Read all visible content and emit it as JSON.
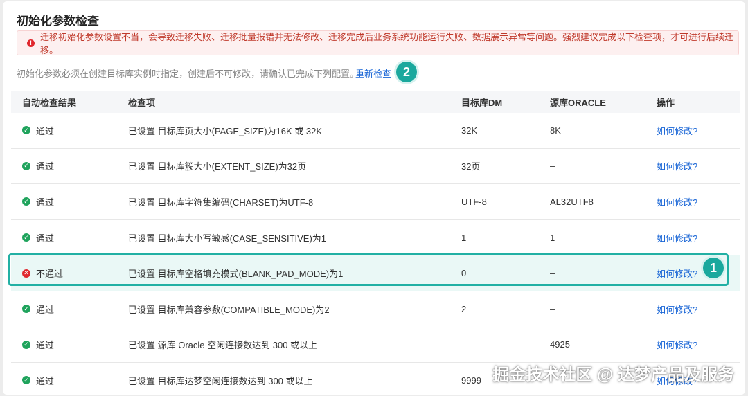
{
  "title": "初始化参数检查",
  "alert": {
    "icon": "alert-circle-icon",
    "text": "迁移初始化参数设置不当，会导致迁移失败、迁移批量报错并无法修改、迁移完成后业务系统功能运行失败、数据展示异常等问题。强烈建议完成以下检查项，才可进行后续迁移。"
  },
  "hint": "初始化参数必须在创建目标库实例时指定，创建后不可修改，请确认已完成下列配置。",
  "recheck_label": "重新检查",
  "step_badges": {
    "recheck": "2",
    "highlighted_row": "1"
  },
  "table": {
    "headers": [
      "自动检查结果",
      "检查项",
      "目标库DM",
      "源库ORACLE",
      "操作"
    ],
    "rows": [
      {
        "status": "通过",
        "ok": true,
        "item": "已设置 目标库页大小(PAGE_SIZE)为16K 或 32K",
        "target": "32K",
        "source": "8K",
        "action": "如何修改?"
      },
      {
        "status": "通过",
        "ok": true,
        "item": "已设置 目标库簇大小(EXTENT_SIZE)为32页",
        "target": "32页",
        "source": "–",
        "action": "如何修改?"
      },
      {
        "status": "通过",
        "ok": true,
        "item": "已设置 目标库字符集编码(CHARSET)为UTF-8",
        "target": "UTF-8",
        "source": "AL32UTF8",
        "action": "如何修改?"
      },
      {
        "status": "通过",
        "ok": true,
        "item": "已设置 目标库大小写敏感(CASE_SENSITIVE)为1",
        "target": "1",
        "source": "1",
        "action": "如何修改?"
      },
      {
        "status": "不通过",
        "ok": false,
        "item": "已设置 目标库空格填充模式(BLANK_PAD_MODE)为1",
        "target": "0",
        "source": "–",
        "action": "如何修改?"
      },
      {
        "status": "通过",
        "ok": true,
        "item": "已设置 目标库兼容参数(COMPATIBLE_MODE)为2",
        "target": "2",
        "source": "–",
        "action": "如何修改?"
      },
      {
        "status": "通过",
        "ok": true,
        "item": "已设置 源库 Oracle 空闲连接数达到 300 或以上",
        "target": "–",
        "source": "4925",
        "action": "如何修改?"
      },
      {
        "status": "通过",
        "ok": true,
        "item": "已设置 目标库达梦空闲连接数达到 300 或以上",
        "target": "9999",
        "source": "",
        "action": "如何修改?"
      }
    ]
  },
  "watermark": "掘金技术社区 @ 达梦产品及服务",
  "colors": {
    "accent": "#1aa89d",
    "link": "#1a66d6",
    "pass": "#1fa35c",
    "fail": "#e0282e"
  }
}
